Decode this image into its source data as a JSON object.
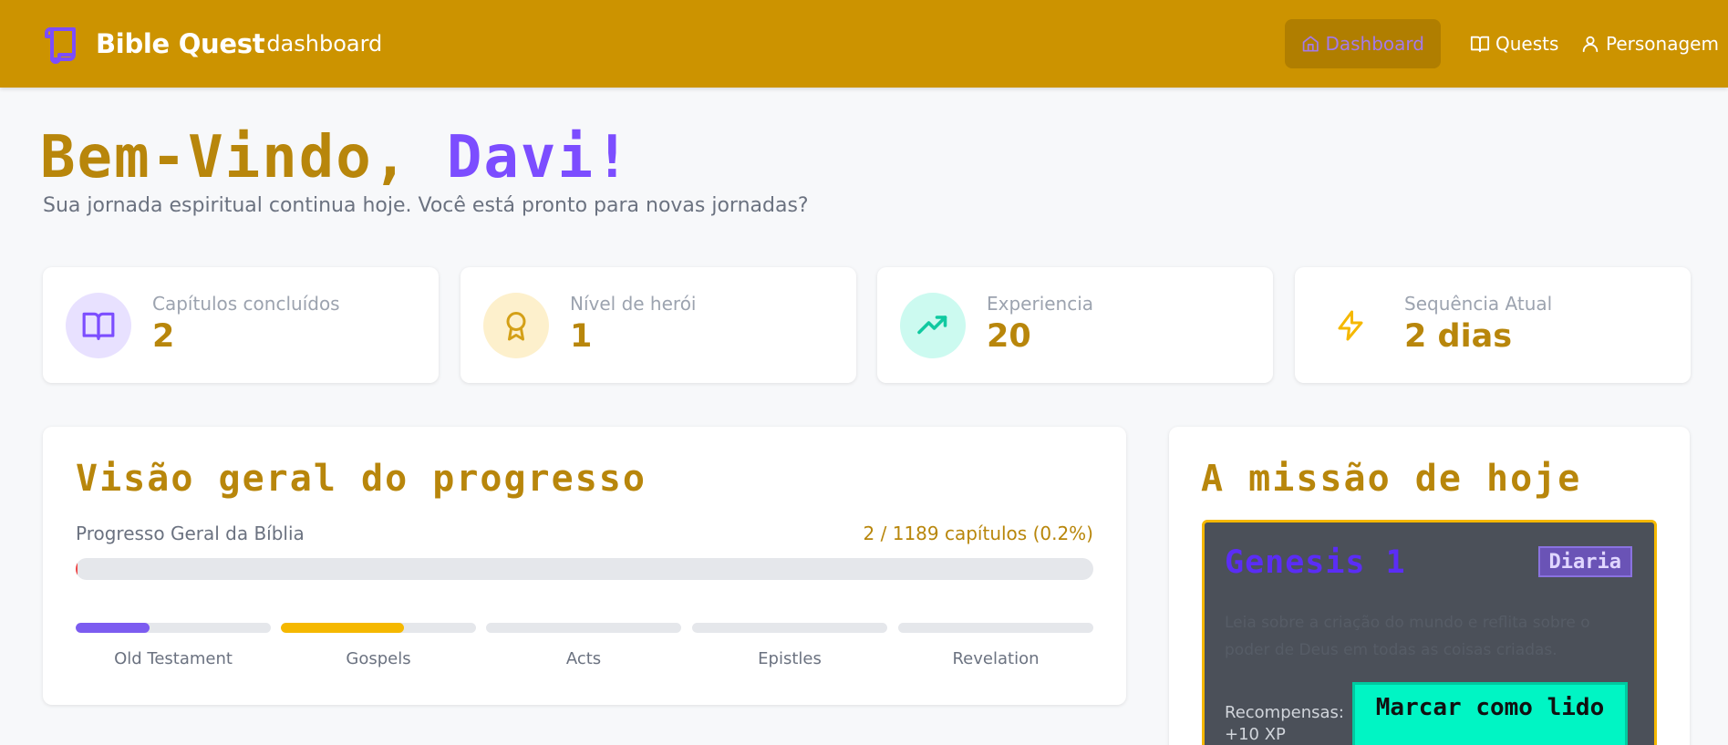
{
  "header": {
    "brand_title": "Bible Quest",
    "brand_subtitle": "dashboard",
    "nav": [
      {
        "label": "Dashboard",
        "icon": "home-icon",
        "active": true
      },
      {
        "label": "Quests",
        "icon": "book-icon",
        "active": false
      },
      {
        "label": "Personagem",
        "icon": "user-icon",
        "active": false
      }
    ]
  },
  "welcome": {
    "greeting": "Bem-Vindo, ",
    "name": "Davi!",
    "tagline": "Sua jornada espiritual continua hoje. Você está pronto para novas jornadas?"
  },
  "stats": [
    {
      "label": "Capítulos concluídos",
      "value": "2",
      "icon": "book-icon"
    },
    {
      "label": "Nível de herói",
      "value": "1",
      "icon": "award-icon"
    },
    {
      "label": "Experiencia",
      "value": "20",
      "icon": "trending-up-icon"
    },
    {
      "label": "Sequência Atual",
      "value": "2 dias",
      "icon": "lightning-icon"
    }
  ],
  "progress": {
    "title": "Visão geral do progresso",
    "overall_label": "Progresso Geral da Bíblia",
    "overall_count": "2 / 1189 capítulos (0.2%)",
    "overall_fraction": 0.002,
    "sections": [
      {
        "label": "Old Testament",
        "fraction": 0.38,
        "color": "#7c5cf0"
      },
      {
        "label": "Gospels",
        "fraction": 0.63,
        "color": "#f5b800"
      },
      {
        "label": "Acts",
        "fraction": 0.0,
        "color": "#e5e7eb"
      },
      {
        "label": "Epistles",
        "fraction": 0.0,
        "color": "#e5e7eb"
      },
      {
        "label": "Revelation",
        "fraction": 0.0,
        "color": "#e5e7eb"
      }
    ]
  },
  "mission": {
    "title": "A missão de hoje",
    "chapter": "Genesis 1",
    "badge": "Diaria",
    "description": "Leia sobre a criação do mundo e reflita sobre o poder de Deus em todas as coisas criadas.",
    "reward_label": "Recompensas:",
    "reward_value": "+10 XP",
    "button": "Marcar como lido"
  },
  "colors": {
    "header": "#cc9300",
    "accent_gold": "#b8860b",
    "accent_purple": "#7c4dff",
    "mint": "#00f5c4"
  }
}
